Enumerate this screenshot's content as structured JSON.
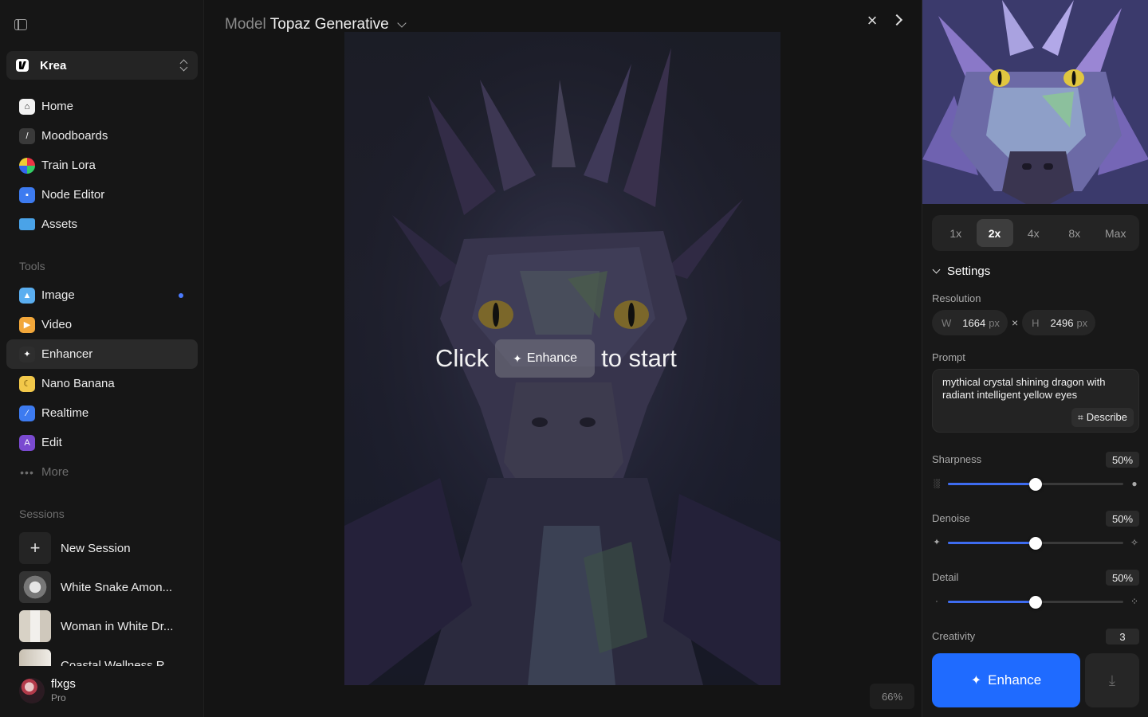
{
  "sidebar": {
    "workspace": "Krea",
    "nav": [
      {
        "label": "Home",
        "icon": "home-icon",
        "color": "#f2f2f2"
      },
      {
        "label": "Moodboards",
        "icon": "moodboard-icon",
        "color": "#3a3a3a"
      },
      {
        "label": "Train Lora",
        "icon": "train-lora-icon",
        "color": "#d04a4a"
      },
      {
        "label": "Node Editor",
        "icon": "node-editor-icon",
        "color": "#3d7bf0"
      },
      {
        "label": "Assets",
        "icon": "folder-icon",
        "color": "#4aa3e8"
      }
    ],
    "tools_label": "Tools",
    "tools": [
      {
        "label": "Image",
        "icon": "image-icon",
        "color": "#5aaef0",
        "dot": true
      },
      {
        "label": "Video",
        "icon": "video-icon",
        "color": "#f2a73a"
      },
      {
        "label": "Enhancer",
        "icon": "enhancer-icon",
        "color": "#2e2e2e",
        "active": true
      },
      {
        "label": "Nano Banana",
        "icon": "banana-icon",
        "color": "#f2c84a"
      },
      {
        "label": "Realtime",
        "icon": "realtime-icon",
        "color": "#3d7bf0"
      },
      {
        "label": "Edit",
        "icon": "edit-icon",
        "color": "#7a4ad0"
      }
    ],
    "more_label": "More",
    "sessions_label": "Sessions",
    "new_session": "New Session",
    "sessions": [
      {
        "label": "White Snake Amon...",
        "thumb": "#8c8c8c"
      },
      {
        "label": "Woman in White Dr...",
        "thumb": "#c9c2b6"
      },
      {
        "label": "Coastal Wellness R...",
        "thumb": "#b8b0a4"
      }
    ],
    "user": {
      "name": "flxgs",
      "plan": "Pro"
    }
  },
  "canvas": {
    "model_key": "Model",
    "model_value": "Topaz Generative",
    "cta_before": "Click",
    "cta_button": "Enhance",
    "cta_after": "to start",
    "zoom": "66%"
  },
  "panel": {
    "scales": [
      "1x",
      "2x",
      "4x",
      "8x",
      "Max"
    ],
    "active_scale": "2x",
    "settings_label": "Settings",
    "resolution_label": "Resolution",
    "width_key": "W",
    "width": "1664",
    "unit": "px",
    "height_key": "H",
    "height": "2496",
    "prompt_label": "Prompt",
    "prompt": "mythical crystal shining dragon with radiant intelligent yellow eyes",
    "describe_label": "Describe",
    "sliders": [
      {
        "label": "Sharpness",
        "value": "50%",
        "fraction": 0.5
      },
      {
        "label": "Denoise",
        "value": "50%",
        "fraction": 0.5
      },
      {
        "label": "Detail",
        "value": "50%",
        "fraction": 0.5
      }
    ],
    "creativity_label": "Creativity",
    "creativity": "3",
    "enhance_label": "Enhance"
  }
}
